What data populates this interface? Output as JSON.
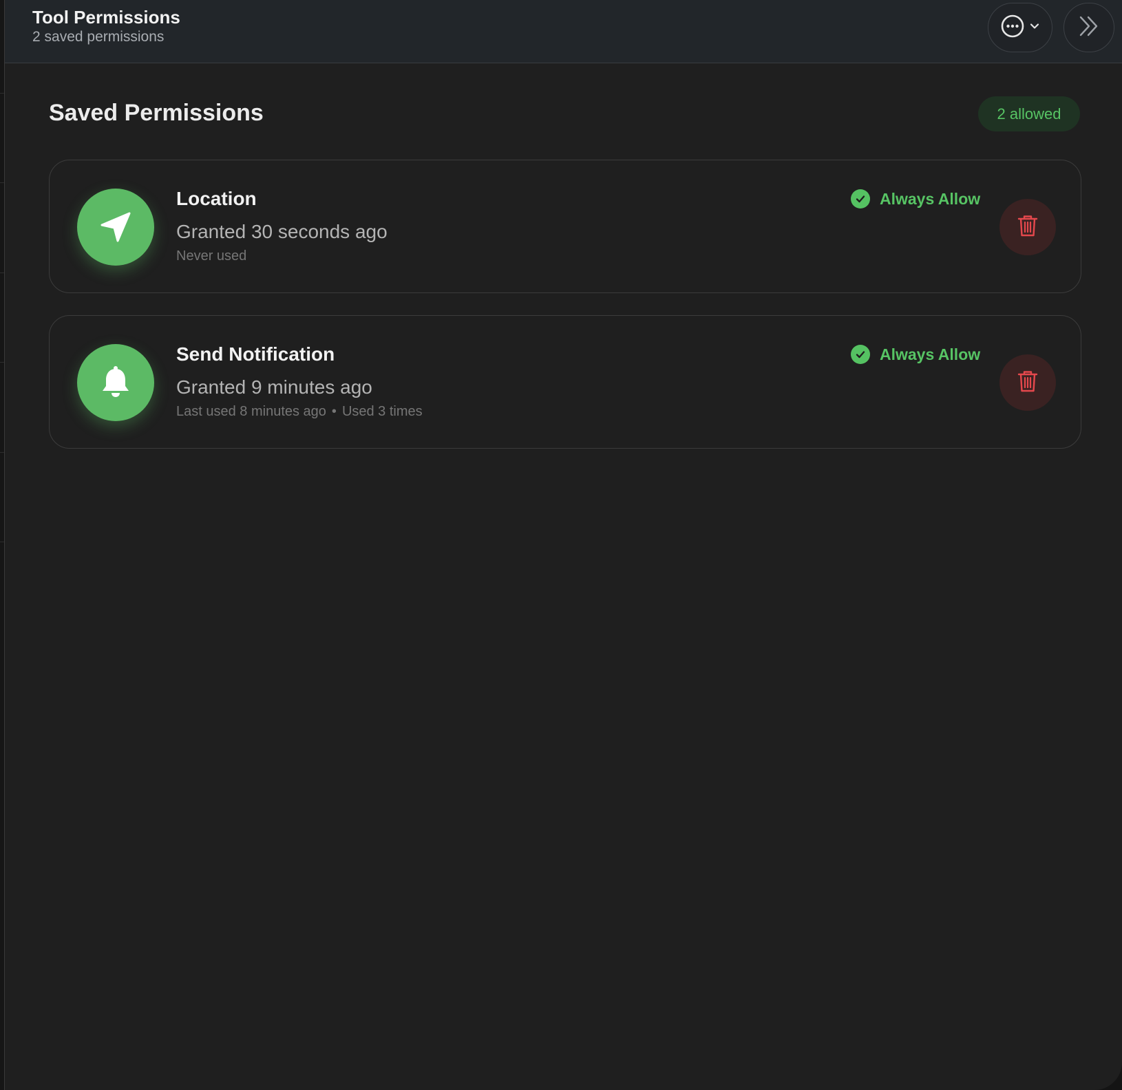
{
  "header": {
    "title": "Tool Permissions",
    "subtitle": "2 saved permissions",
    "more_icon": "ellipsis-circle-icon",
    "expand_icon": "double-chevron-right-icon"
  },
  "section": {
    "title": "Saved Permissions",
    "badge": "2 allowed"
  },
  "permissions": [
    {
      "name": "Location",
      "icon": "location-arrow-icon",
      "granted": "Granted 30 seconds ago",
      "usage": "Never used",
      "usage_extra": "",
      "status": "Always Allow"
    },
    {
      "name": "Send Notification",
      "icon": "bell-icon",
      "granted": "Granted 9 minutes ago",
      "usage": "Last used 8 minutes ago",
      "usage_extra": "Used 3 times",
      "status": "Always Allow"
    }
  ],
  "colors": {
    "accent_green": "#5cba65",
    "status_green": "#57c464",
    "danger_red": "#e5484d",
    "background": "#1f1f1f",
    "header_bg": "#22262a"
  }
}
